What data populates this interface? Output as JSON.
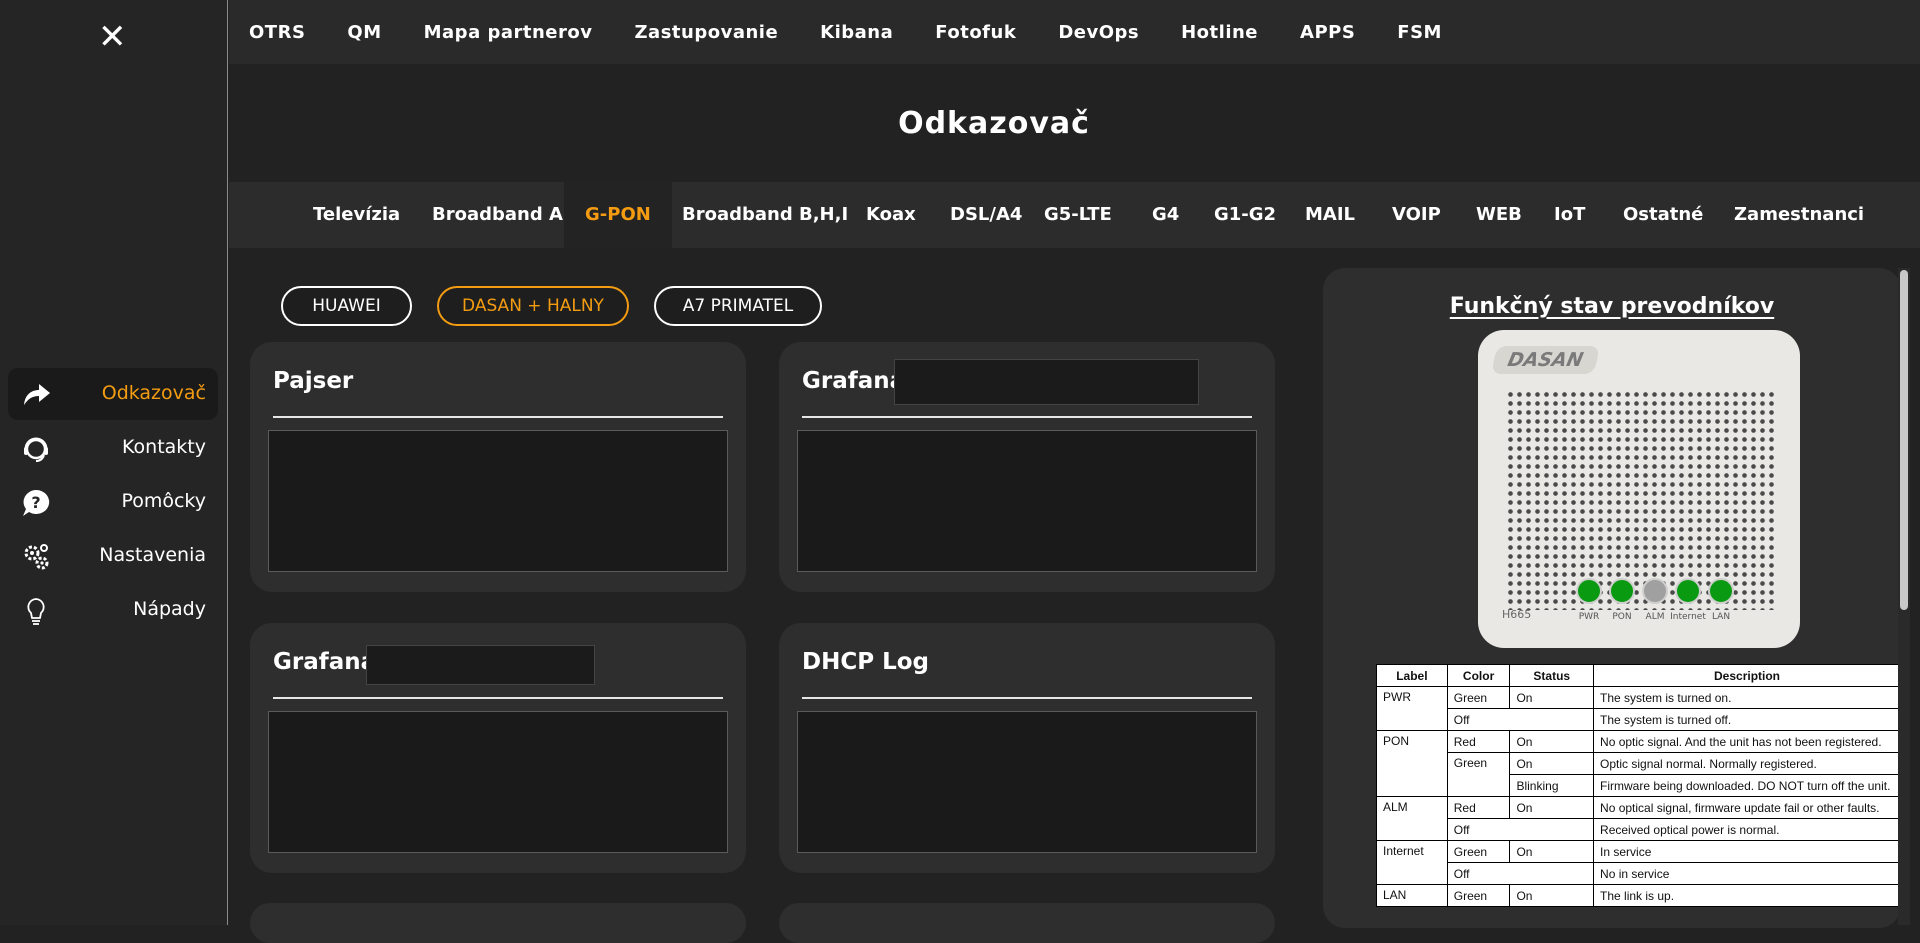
{
  "sidebar": {
    "close_glyph": "✕",
    "items": [
      {
        "label": "Odkazovač",
        "icon": "share-arrow-icon",
        "active": true
      },
      {
        "label": "Kontakty",
        "icon": "headset-icon",
        "active": false
      },
      {
        "label": "Pomôcky",
        "icon": "help-bubble-icon",
        "active": false
      },
      {
        "label": "Nastavenia",
        "icon": "gears-icon",
        "active": false
      },
      {
        "label": "Nápady",
        "icon": "lightbulb-icon",
        "active": false
      }
    ]
  },
  "topnav": [
    "OTRS",
    "QM",
    "Mapa partnerov",
    "Zastupovanie",
    "Kibana",
    "Fotofuk",
    "DevOps",
    "Hotline",
    "APPS",
    "FSM"
  ],
  "page_title": "Odkazovač",
  "categories": [
    "Televízia",
    "Broadband A",
    "G-PON",
    "Broadband B,H,I",
    "Koax",
    "DSL/A4",
    "G5-LTE",
    "G4",
    "G1-G2",
    "MAIL",
    "VOIP",
    "WEB",
    "IoT",
    "Ostatné",
    "Zamestnanci"
  ],
  "active_category": "G-PON",
  "vendors": [
    {
      "label": "HUAWEI",
      "active": false
    },
    {
      "label": "DASAN + HALNY",
      "active": true
    },
    {
      "label": "A7 PRIMATEL",
      "active": false
    }
  ],
  "cards": [
    {
      "title": "Pajser"
    },
    {
      "title": "Grafana"
    },
    {
      "title": "Grafana"
    },
    {
      "title": "DHCP Log"
    }
  ],
  "right_panel": {
    "title": "Funkčný stav prevodníkov",
    "device": {
      "brand": "DASAN",
      "model": "H665",
      "leds": [
        {
          "label": "PWR",
          "color": "#0a9a12"
        },
        {
          "label": "PON",
          "color": "#0a9a12"
        },
        {
          "label": "ALM",
          "color": "#a0a0a0"
        },
        {
          "label": "Internet",
          "color": "#0a9a12"
        },
        {
          "label": "LAN",
          "color": "#0a9a12"
        }
      ]
    },
    "table": {
      "headers": [
        "Label",
        "Color",
        "Status",
        "Description"
      ],
      "rows": [
        [
          "PWR",
          "Green",
          "On",
          "The system is turned on."
        ],
        [
          "",
          "Off",
          "",
          "The system is turned off."
        ],
        [
          "PON",
          "Red",
          "On",
          "No optic signal. And the unit has not been registered."
        ],
        [
          "",
          "Green",
          "On",
          "Optic signal normal. Normally registered."
        ],
        [
          "",
          "",
          "Blinking",
          "Firmware being downloaded. DO NOT turn off the unit."
        ],
        [
          "ALM",
          "Red",
          "On",
          "No optical signal, firmware update fail or other faults."
        ],
        [
          "",
          "Off",
          "",
          "Received optical power is normal."
        ],
        [
          "Internet",
          "Green",
          "On",
          "In service"
        ],
        [
          "",
          "Off",
          "",
          "No in service"
        ],
        [
          "LAN",
          "Green",
          "On",
          "The link is up."
        ]
      ]
    }
  },
  "colors": {
    "accent": "#f39c12",
    "background": "#222222",
    "card": "#2e2e2e"
  }
}
